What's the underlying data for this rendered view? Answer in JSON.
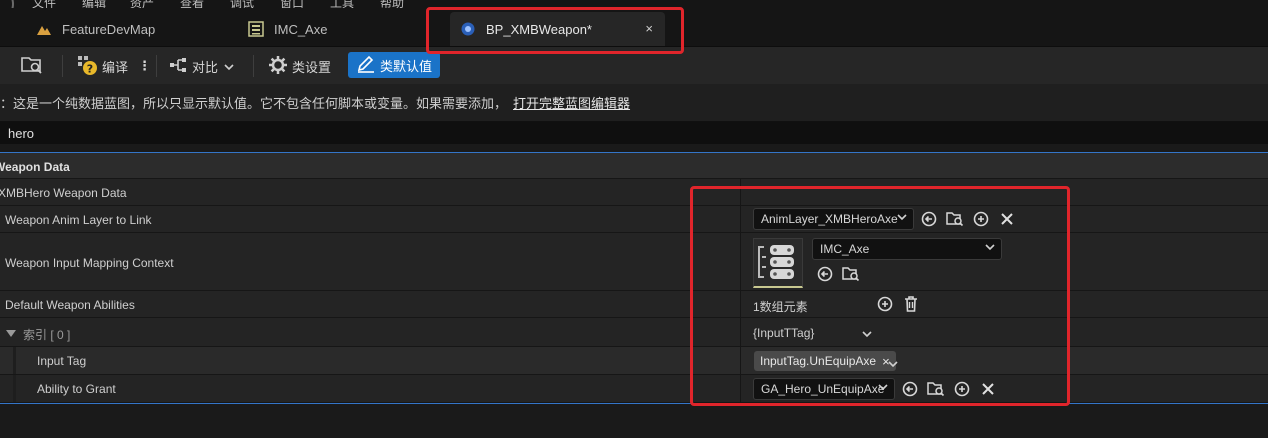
{
  "menu": [
    "文件",
    "编辑",
    "资产",
    "查看",
    "调试",
    "窗口",
    "工具",
    "帮助"
  ],
  "tabs": [
    {
      "label": "FeatureDevMap",
      "icon": "level-map-icon",
      "active": false
    },
    {
      "label": "IMC_Axe",
      "icon": "input-mapping-icon",
      "active": false
    },
    {
      "label": "BP_XMBWeapon*",
      "icon": "blueprint-icon",
      "active": true,
      "close": "×"
    }
  ],
  "toolbar": {
    "compile": "编译",
    "diff": "对比",
    "class_settings": "类设置",
    "class_defaults": "类默认值"
  },
  "notice": {
    "text": "：这是一个纯数据蓝图，所以只显示默认值。它不包含任何脚本或变量。如果需要添加，",
    "link": "打开完整蓝图编辑器"
  },
  "search": {
    "value": "hero"
  },
  "details": {
    "category": "Weapon Data",
    "subcategory": "XMBHero Weapon Data",
    "rows": {
      "anim_layer": {
        "label": "Weapon Anim Layer to Link",
        "value": "AnimLayer_XMBHeroAxe"
      },
      "input_mapping": {
        "label": "Weapon Input Mapping Context",
        "value": "IMC_Axe"
      },
      "abilities": {
        "label": "Default Weapon Abilities",
        "value": "1数组元素"
      },
      "index": {
        "label": "索引 [ 0 ]",
        "value": "{InputTTag}"
      },
      "input_tag": {
        "label": "Input Tag",
        "value": "InputTag.UnEquipAxe",
        "remove": "×"
      },
      "ability_grant": {
        "label": "Ability to Grant",
        "value": "GA_Hero_UnEquipAxe"
      }
    }
  },
  "colors": {
    "accent": "#1a73c8",
    "highlight": "#e0252b",
    "separator": "#3475c8"
  }
}
